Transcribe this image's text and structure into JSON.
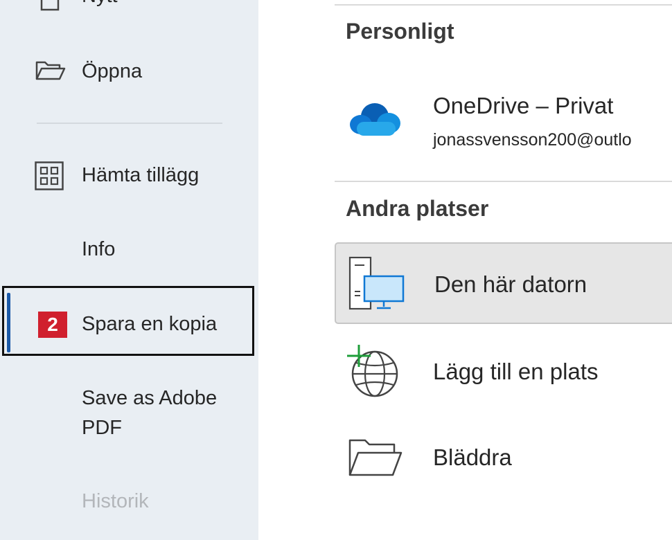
{
  "sidebar": {
    "items": [
      {
        "id": "new",
        "label": "Nytt"
      },
      {
        "id": "open",
        "label": "Öppna"
      },
      {
        "id": "addins",
        "label": "Hämta tillägg"
      },
      {
        "id": "info",
        "label": "Info"
      },
      {
        "id": "save-copy",
        "label": "Spara en kopia",
        "selected": true
      },
      {
        "id": "save-pdf",
        "label_line1": "Save as Adobe",
        "label_line2": "PDF"
      },
      {
        "id": "history",
        "label": "Historik",
        "disabled": true
      }
    ],
    "step_badge": "2"
  },
  "main": {
    "personal_title": "Personligt",
    "onedrive": {
      "title": "OneDrive – Privat",
      "email": "jonassvensson200@outlo"
    },
    "other_title": "Andra platser",
    "locations": [
      {
        "id": "this-pc",
        "label": "Den här datorn",
        "selected": true
      },
      {
        "id": "add-place",
        "label": "Lägg till en plats"
      },
      {
        "id": "browse",
        "label": "Bläddra"
      }
    ]
  },
  "colors": {
    "sidebar_bg": "#e9eef3",
    "selection_bar": "#1c5aa8",
    "badge": "#d0202e",
    "onedrive_blue": "#0f78d4",
    "add_place_plus": "#1e9e3a"
  },
  "icons": [
    "new-document-icon",
    "folder-open-icon",
    "addins-grid-icon",
    "onedrive-cloud-icon",
    "this-pc-icon",
    "add-place-globe-icon",
    "browse-folder-icon"
  ]
}
